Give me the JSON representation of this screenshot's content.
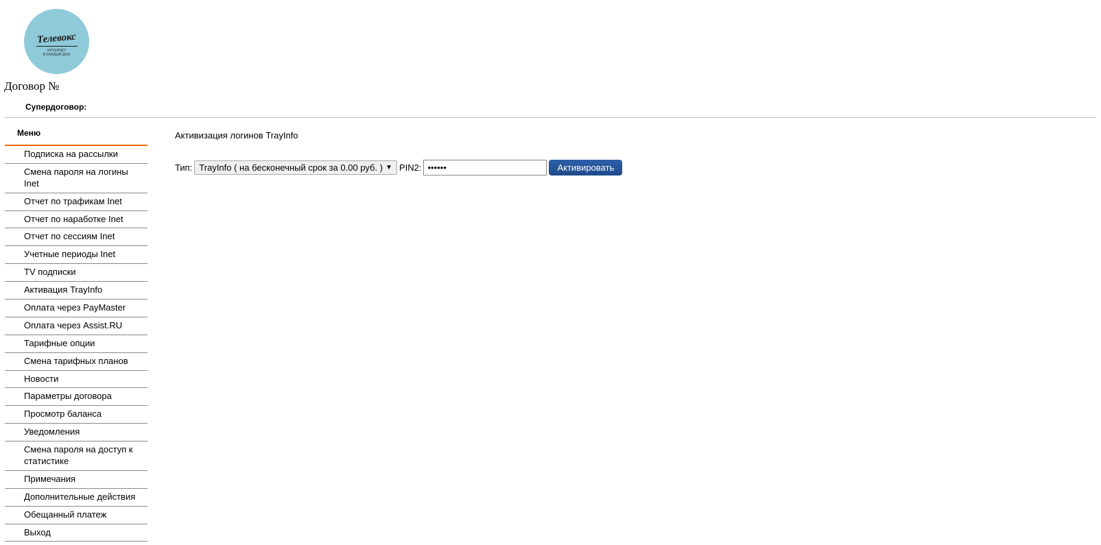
{
  "logo": {
    "brand_text": "Телевокс",
    "sub1": "ИНТЕРНЕТ",
    "sub2": "В КАЖДЫЙ ДОМ"
  },
  "header": {
    "contract_label": "Договор №",
    "super_label": "Супердоговор:"
  },
  "sidebar": {
    "menu_title": "Меню",
    "items": [
      {
        "label": "Подписка на рассылки"
      },
      {
        "label": "Смена пароля на логины Inet"
      },
      {
        "label": "Отчет по трафикам Inet"
      },
      {
        "label": "Отчет по наработке Inet"
      },
      {
        "label": "Отчет по сессиям Inet"
      },
      {
        "label": "Учетные периоды Inet"
      },
      {
        "label": "TV подписки"
      },
      {
        "label": "Активация TrayInfo"
      },
      {
        "label": "Оплата через PayMaster"
      },
      {
        "label": "Оплата через Assist.RU"
      },
      {
        "label": "Тарифные опции"
      },
      {
        "label": "Смена тарифных планов"
      },
      {
        "label": "Новости"
      },
      {
        "label": "Параметры договора"
      },
      {
        "label": "Просмотр баланса"
      },
      {
        "label": "Уведомления"
      },
      {
        "label": "Смена пароля на доступ к статистике"
      },
      {
        "label": "Примечания"
      },
      {
        "label": "Дополнительные действия"
      },
      {
        "label": "Обещанный платеж"
      },
      {
        "label": "Выход"
      }
    ]
  },
  "main": {
    "title": "Активизация логинов TrayInfo",
    "type_label": "Тип:",
    "type_value": "TrayInfo ( на бесконечный срок за 0.00 руб. )",
    "pin_label": "PIN2:",
    "pin_value": "••••••",
    "activate_button": "Активировать"
  }
}
